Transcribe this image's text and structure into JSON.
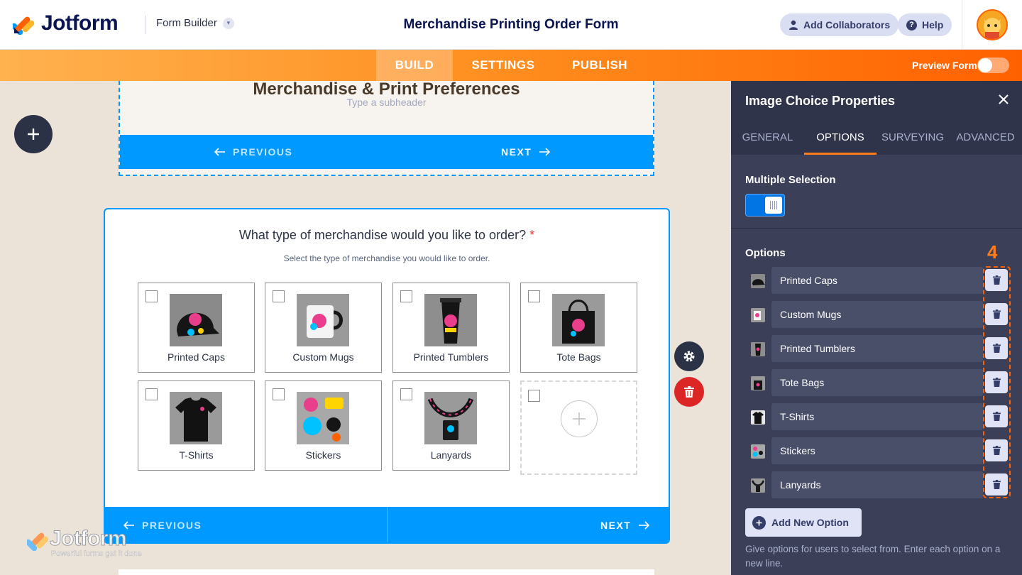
{
  "header": {
    "brand": "Jotform",
    "builder_label": "Form Builder",
    "form_title": "Merchandise Printing Order Form",
    "add_collaborators": "Add Collaborators",
    "help": "Help"
  },
  "nav": {
    "build": "BUILD",
    "settings": "SETTINGS",
    "publish": "PUBLISH",
    "preview_label": "Preview Form",
    "preview_on": false
  },
  "page1": {
    "header": "Merchandise & Print Preferences",
    "subheader_placeholder": "Type a subheader",
    "previous": "PREVIOUS",
    "next": "NEXT"
  },
  "question": {
    "label": "What type of merchandise would you like to order?",
    "required_mark": "*",
    "sublabel": "Select the type of merchandise you would like to order.",
    "choices": [
      {
        "label": "Printed Caps",
        "icon": "cap-image"
      },
      {
        "label": "Custom Mugs",
        "icon": "mug-image"
      },
      {
        "label": "Printed Tumblers",
        "icon": "tumbler-image"
      },
      {
        "label": "Tote Bags",
        "icon": "tote-bag-image"
      },
      {
        "label": "T-Shirts",
        "icon": "tshirt-image"
      },
      {
        "label": "Stickers",
        "icon": "stickers-image"
      },
      {
        "label": "Lanyards",
        "icon": "lanyard-image"
      }
    ],
    "previous": "PREVIOUS",
    "next": "NEXT"
  },
  "watermark": {
    "brand": "Jotform",
    "tagline": "Powerful forms get it done"
  },
  "panel": {
    "title": "Image Choice Properties",
    "tabs": [
      "GENERAL",
      "OPTIONS",
      "SURVEYING",
      "ADVANCED"
    ],
    "active_tab": "OPTIONS",
    "multiple_selection_label": "Multiple Selection",
    "multiple_selection_on": true,
    "options_label": "Options",
    "annotation": "4",
    "options": [
      "Printed Caps",
      "Custom Mugs",
      "Printed Tumblers",
      "Tote Bags",
      "T-Shirts",
      "Stickers",
      "Lanyards"
    ],
    "add_option": "Add New Option",
    "help_text": "Give options for users to select from. Enter each option on a new line."
  },
  "colors": {
    "brand_navy": "#0a1551",
    "accent_blue": "#0099ff",
    "accent_orange": "#ff6100",
    "panel_bg": "#3b3f57",
    "danger": "#dc2626"
  }
}
